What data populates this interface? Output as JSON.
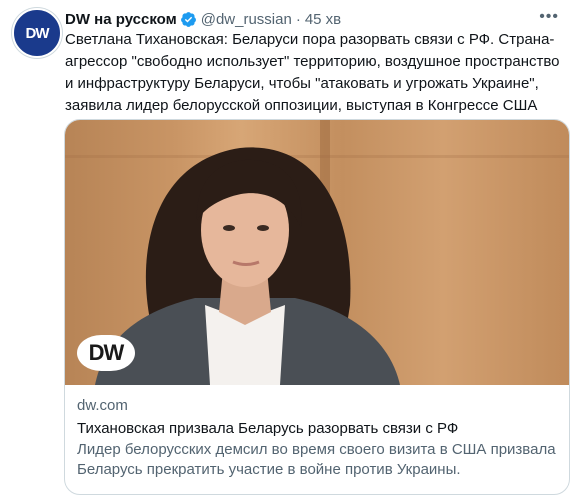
{
  "author": {
    "avatar_text": "DW",
    "name": "DW на русском",
    "handle": "@dw_russian",
    "separator": "·",
    "time": "45 хв",
    "verified_icon": "verified-badge-icon",
    "more_icon": "more-options-icon"
  },
  "tweet": {
    "text": "Светлана Тихановская: Беларуси пора разорвать связи с РФ. Страна-агрессор \"свободно использует\" территорию, воздушное пространство и инфраструктуру Беларуси, чтобы \"атаковать и угрожать Украине\", заявила лидер белорусской оппозиции, выступая в Конгрессе США"
  },
  "card": {
    "logo_text": "DW",
    "domain": "dw.com",
    "title": "Тихановская призвала Беларусь разорвать связи с РФ",
    "description": "Лидер белорусских демсил во время своего визита в США призвала Беларусь прекратить участие в войне против Украины."
  },
  "colors": {
    "brand": "#1a3a8c",
    "verified": "#1d9bf0",
    "secondary_text": "#536471",
    "border": "#cfd9de"
  }
}
